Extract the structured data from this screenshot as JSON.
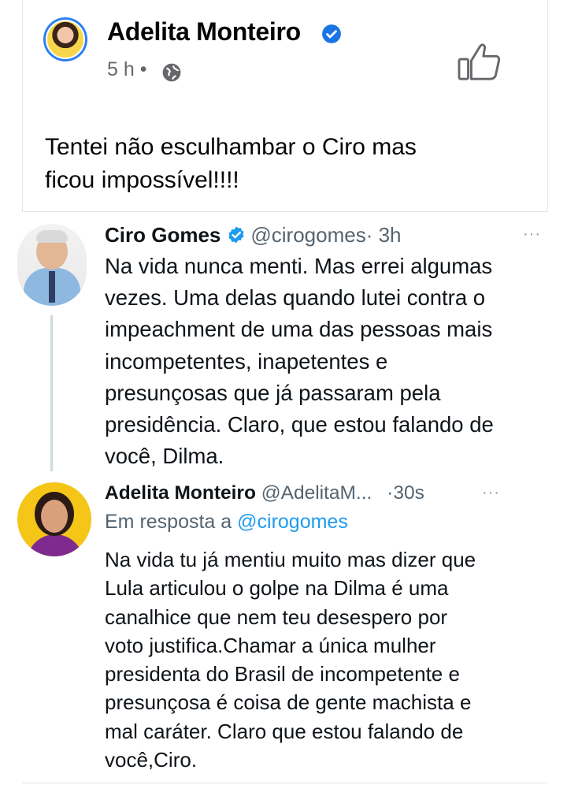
{
  "facebook_post": {
    "author_name": "Adelita Monteiro",
    "time": "5 h",
    "separator": "•",
    "text_line1": "Tentei não esculhambar o Ciro mas",
    "text_line2": "ficou impossível!!!!"
  },
  "tweet_1": {
    "name": "Ciro Gomes",
    "handle": "@cirogomes",
    "time": "· 3h",
    "more": "···",
    "lines": [
      "Na vida nunca menti. Mas errei algumas",
      "vezes. Uma delas quando lutei contra o",
      "impeachment de uma das pessoas mais",
      "incompetentes, inapetentes e",
      "presunçosas que já passaram pela",
      "presidência. Claro, que estou falando de",
      "você, Dilma."
    ]
  },
  "tweet_2": {
    "name": "Adelita Monteiro",
    "handle": "@AdelitaM...",
    "time": "·30s",
    "more": "···",
    "reply_prefix": "Em resposta a",
    "reply_handle": "@cirogomes",
    "lines": [
      "Na vida tu já mentiu muito mas dizer que",
      "Lula articulou o golpe na Dilma é uma",
      "canalhice que nem teu desespero por",
      "voto justifica.Chamar a única mulher",
      "presidenta do Brasil de incompetente e",
      "presunçosa é coisa de gente machista e",
      "mal caráter. Claro que estou falando de",
      "você,Ciro."
    ]
  },
  "colors": {
    "verified_blue": "#1d9bf0",
    "facebook_blue": "#2d7ff0",
    "muted_gray": "#65676b",
    "handle_gray": "#536471"
  },
  "icons": {
    "verified": "verified-badge-icon",
    "globe": "globe-icon",
    "like": "thumbs-up-icon",
    "more": "more-options-icon"
  }
}
